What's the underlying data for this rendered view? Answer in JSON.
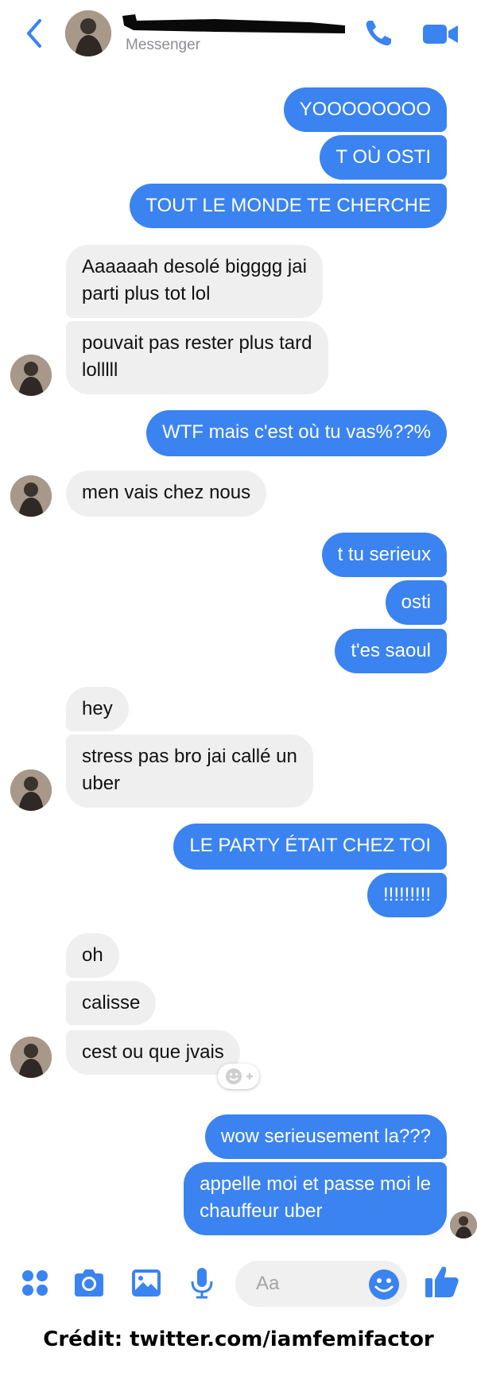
{
  "header": {
    "subtitle": "Messenger",
    "back_icon": "chevron-left-icon",
    "call_icon": "phone-icon",
    "video_icon": "video-camera-icon",
    "accent": "#3a83f1"
  },
  "messages": [
    {
      "side": "out",
      "text": "YOOOOOOOO"
    },
    {
      "side": "out",
      "text": "T OÙ OSTI"
    },
    {
      "side": "out",
      "text": "TOUT LE MONDE TE CHERCHE"
    },
    {
      "side": "in",
      "text": "Aaaaaah desolé bigggg jai parti plus tot lol",
      "lines": [
        "Aaaaaah desolé bigggg jai",
        "parti plus tot lol"
      ]
    },
    {
      "side": "in",
      "text": "pouvait pas rester plus tard lolllll",
      "lines": [
        "pouvait pas rester plus tard",
        "lolllll"
      ]
    },
    {
      "side": "out",
      "text": "WTF mais c'est où tu vas%??%"
    },
    {
      "side": "in",
      "text": "men vais chez nous"
    },
    {
      "side": "out",
      "text": "t tu serieux"
    },
    {
      "side": "out",
      "text": "osti"
    },
    {
      "side": "out",
      "text": "t'es saoul"
    },
    {
      "side": "in",
      "text": "hey"
    },
    {
      "side": "in",
      "text": "stress pas bro jai callé un uber",
      "lines": [
        "stress pas bro jai callé un",
        "uber"
      ]
    },
    {
      "side": "out",
      "text": "LE PARTY ÉTAIT CHEZ TOI"
    },
    {
      "side": "out",
      "text": "!!!!!!!!!"
    },
    {
      "side": "in",
      "text": "oh"
    },
    {
      "side": "in",
      "text": "calisse"
    },
    {
      "side": "in",
      "text": "cest ou que jvais"
    },
    {
      "side": "out",
      "text": "wow serieusement la???"
    },
    {
      "side": "out",
      "text": "appelle moi et passe moi le chauffeur uber",
      "lines": [
        "appelle moi et passe moi le",
        "chauffeur uber"
      ]
    }
  ],
  "composer": {
    "placeholder": "Aa",
    "icons": [
      "apps-icon",
      "camera-icon",
      "image-icon",
      "microphone-icon",
      "emoji-icon",
      "thumbs-up-icon"
    ]
  },
  "credit": "Crédit: twitter.com/iamfemifactor"
}
